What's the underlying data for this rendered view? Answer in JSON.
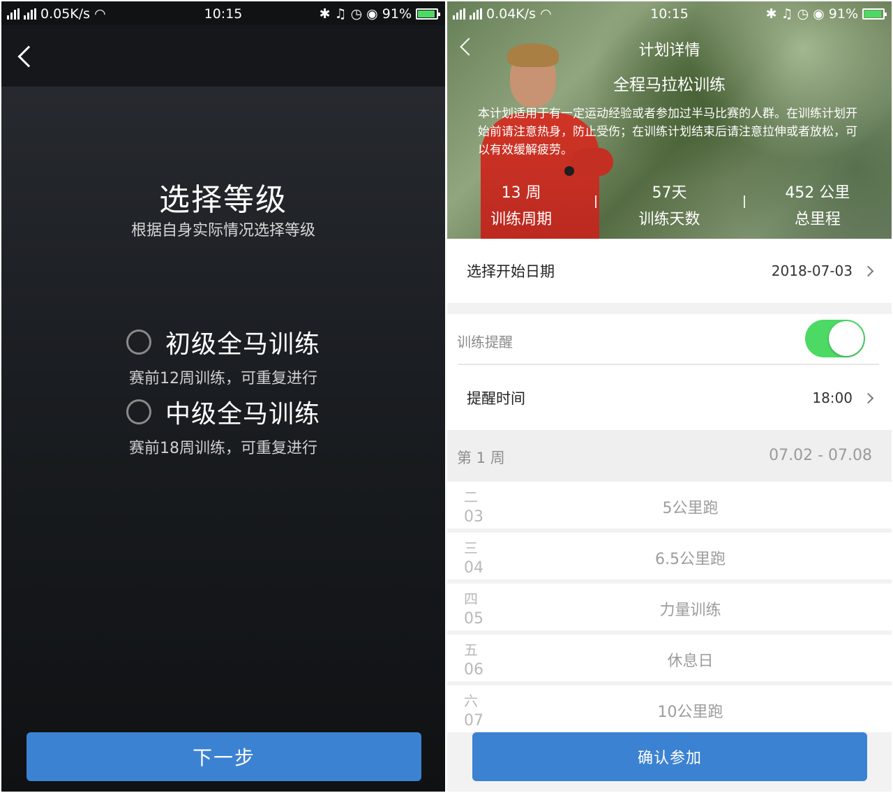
{
  "left": {
    "status": {
      "speed": "0.05K/s",
      "time": "10:15",
      "battery": "91%"
    },
    "title": "选择等级",
    "subtitle": "根据自身实际情况选择等级",
    "options": [
      {
        "label": "初级全马训练",
        "desc": "赛前12周训练，可重复进行"
      },
      {
        "label": "中级全马训练",
        "desc": "赛前18周训练，可重复进行"
      }
    ],
    "next_label": "下一步"
  },
  "right": {
    "status": {
      "speed": "0.04K/s",
      "time": "10:15",
      "battery": "91%"
    },
    "header_title": "计划详情",
    "plan_name": "全程马拉松训练",
    "plan_desc": "本计划适用于有一定运动经验或者参加过半马比赛的人群。在训练计划开始前请注意热身，防止受伤；在训练计划结束后请注意拉伸或者放松，可以有效缓解疲劳。",
    "stats": [
      {
        "value": "13 周",
        "label": "训练周期"
      },
      {
        "value": "57天",
        "label": "训练天数"
      },
      {
        "value": "452 公里",
        "label": "总里程"
      }
    ],
    "start_date_label": "选择开始日期",
    "start_date_value": "2018-07-03",
    "reminder_label": "训练提醒",
    "reminder_on": true,
    "reminder_time_label": "提醒时间",
    "reminder_time_value": "18:00",
    "week_label": "第 1 周",
    "week_range": "07.02 - 07.08",
    "days": [
      {
        "dow": "二",
        "date": "03",
        "task": "5公里跑"
      },
      {
        "dow": "三",
        "date": "04",
        "task": "6.5公里跑"
      },
      {
        "dow": "四",
        "date": "05",
        "task": "力量训练"
      },
      {
        "dow": "五",
        "date": "06",
        "task": "休息日"
      },
      {
        "dow": "六",
        "date": "07",
        "task": "10公里跑"
      }
    ],
    "confirm_label": "确认参加"
  },
  "colors": {
    "primary_button": "#3b82d2",
    "toggle_on": "#4cd964"
  }
}
